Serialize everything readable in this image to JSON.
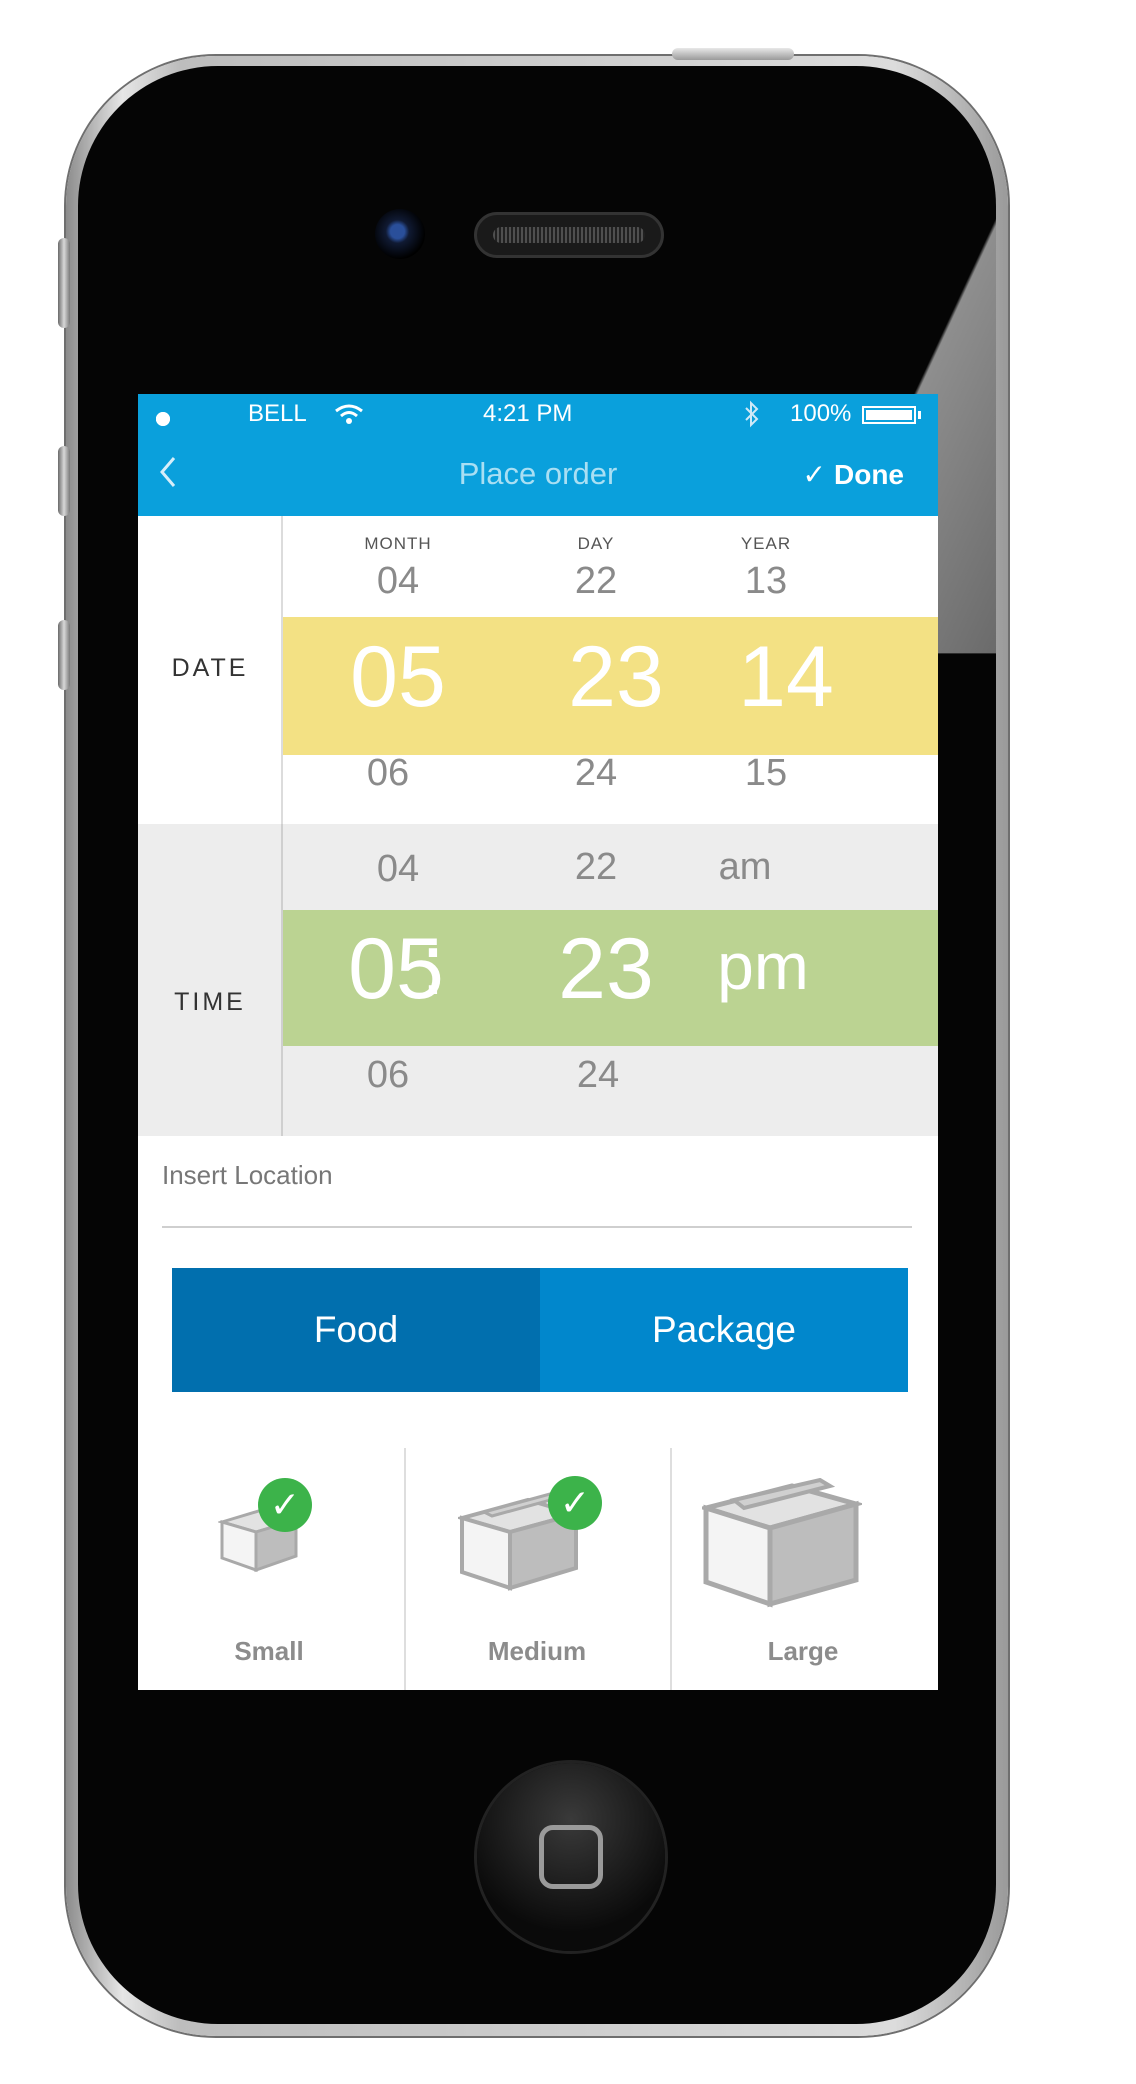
{
  "status_bar": {
    "carrier": "BELL",
    "time": "4:21 PM",
    "battery": "100%"
  },
  "nav": {
    "back_icon": "chevron-left-icon",
    "title": "Place order",
    "done_label": "Done",
    "done_icon": "checkmark-icon"
  },
  "date_picker": {
    "label": "DATE",
    "columns": [
      {
        "header": "MONTH",
        "prev": "04",
        "selected": "05",
        "next": "06"
      },
      {
        "header": "DAY",
        "prev": "22",
        "selected": "23",
        "next": "24"
      },
      {
        "header": "YEAR",
        "prev": "13",
        "selected": "14",
        "next": "15"
      }
    ],
    "highlight_color": "#f3e184"
  },
  "time_picker": {
    "label": "TIME",
    "hour": {
      "prev": "04",
      "selected": "05",
      "next": "06"
    },
    "separator": ":",
    "minute": {
      "prev": "22",
      "selected": "23",
      "next": "24"
    },
    "ampm": {
      "prev": "am",
      "selected": "pm"
    },
    "highlight_color": "#bbd392"
  },
  "location": {
    "placeholder": "Insert Location"
  },
  "category": {
    "options": [
      "Food",
      "Package"
    ],
    "selected": "Food"
  },
  "sizes": [
    {
      "label": "Small",
      "icon": "small-box-icon",
      "checked": true
    },
    {
      "label": "Medium",
      "icon": "medium-box-icon",
      "checked": true
    },
    {
      "label": "Large",
      "icon": "large-box-icon",
      "checked": false
    }
  ],
  "colors": {
    "nav": "#0aa0dc",
    "segment_selected": "#016fae",
    "segment": "#0187cc",
    "check_badge": "#3cb34a"
  }
}
